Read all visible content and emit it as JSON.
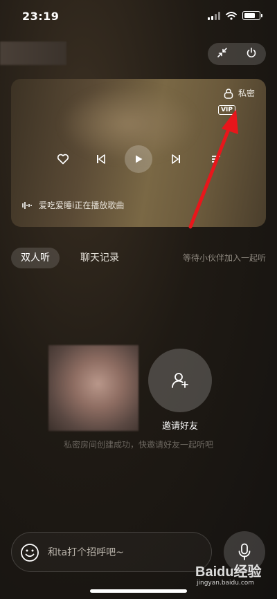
{
  "status_bar": {
    "time": "23:19"
  },
  "player": {
    "private_label": "私密",
    "vip_label": "VIP",
    "now_playing": "爱吃爱睡i正在播放歌曲"
  },
  "tabs": [
    {
      "label": "双人听",
      "active": true
    },
    {
      "label": "聊天记录",
      "active": false
    }
  ],
  "waiting_text": "等待小伙伴加入一起听",
  "invite": {
    "label": "邀请好友"
  },
  "room_created_message": "私密房间创建成功，快邀请好友一起听吧",
  "chat": {
    "placeholder": "和ta打个招呼吧~"
  },
  "watermark": {
    "brand": "Baidu经验",
    "url": "jingyan.baidu.com"
  },
  "colors": {
    "annotation_arrow": "#e8161b",
    "background": "#1f1a14"
  }
}
